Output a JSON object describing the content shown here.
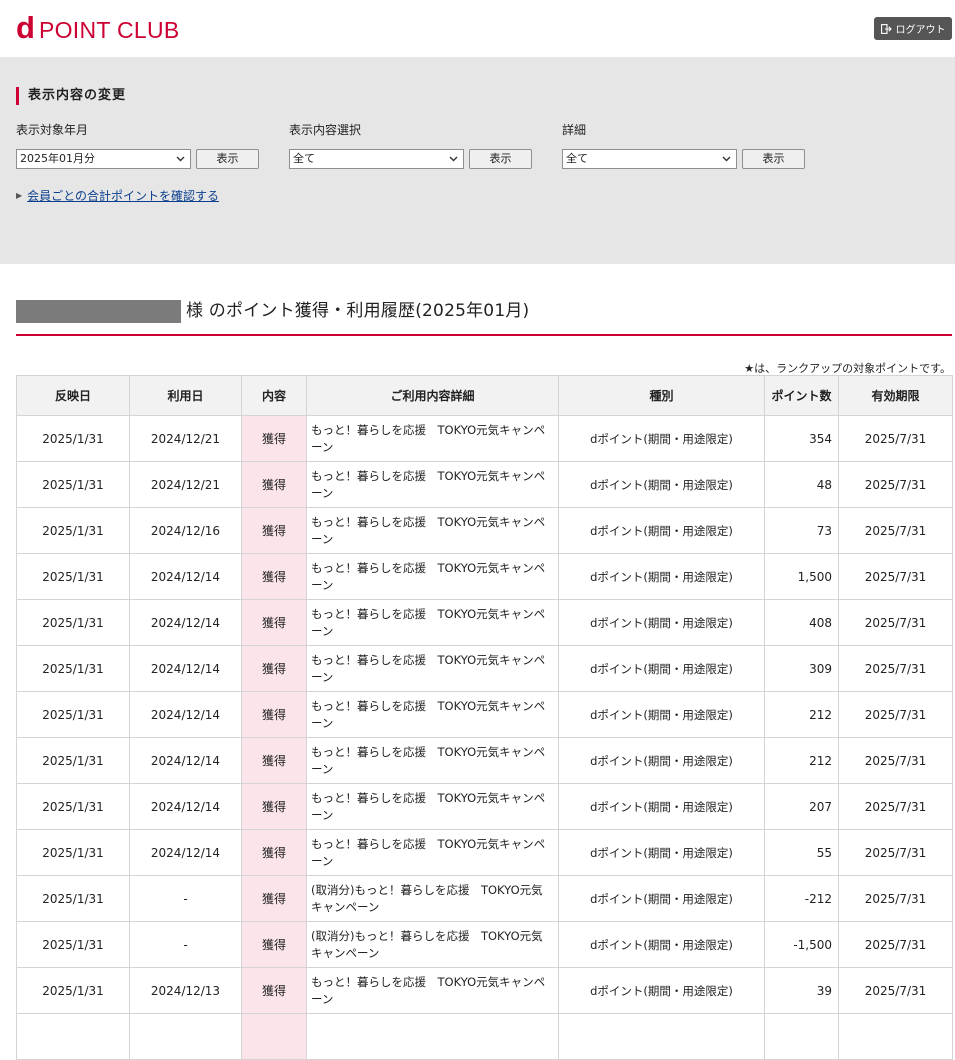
{
  "brand": {
    "logo_d": "d",
    "logo_text": "POINT CLUB"
  },
  "header": {
    "logout_label": "ログアウト"
  },
  "display_change": {
    "title": "表示内容の変更",
    "fields": [
      {
        "label": "表示対象年月",
        "selected": "2025年01月分",
        "button": "表示"
      },
      {
        "label": "表示内容選択",
        "selected": "全て",
        "button": "表示"
      },
      {
        "label": "詳細",
        "selected": "全て",
        "button": "表示"
      }
    ],
    "total_link": "会員ごとの合計ポイントを確認する"
  },
  "history": {
    "title": "様 のポイント獲得・利用履歴(2025年01月)",
    "note": "★は、ランクアップの対象ポイントです。",
    "columns": [
      "反映日",
      "利用日",
      "内容",
      "ご利用内容詳細",
      "種別",
      "ポイント数",
      "有効期限"
    ],
    "rows": [
      {
        "reflect": "2025/1/31",
        "use": "2024/12/21",
        "kind": "獲得",
        "detail": "もっと！暮らしを応援　TOKYO元気キャンペーン",
        "type": "dポイント(期間・用途限定)",
        "points": "354",
        "expiry": "2025/7/31"
      },
      {
        "reflect": "2025/1/31",
        "use": "2024/12/21",
        "kind": "獲得",
        "detail": "もっと！暮らしを応援　TOKYO元気キャンペーン",
        "type": "dポイント(期間・用途限定)",
        "points": "48",
        "expiry": "2025/7/31"
      },
      {
        "reflect": "2025/1/31",
        "use": "2024/12/16",
        "kind": "獲得",
        "detail": "もっと！暮らしを応援　TOKYO元気キャンペーン",
        "type": "dポイント(期間・用途限定)",
        "points": "73",
        "expiry": "2025/7/31"
      },
      {
        "reflect": "2025/1/31",
        "use": "2024/12/14",
        "kind": "獲得",
        "detail": "もっと！暮らしを応援　TOKYO元気キャンペーン",
        "type": "dポイント(期間・用途限定)",
        "points": "1,500",
        "expiry": "2025/7/31"
      },
      {
        "reflect": "2025/1/31",
        "use": "2024/12/14",
        "kind": "獲得",
        "detail": "もっと！暮らしを応援　TOKYO元気キャンペーン",
        "type": "dポイント(期間・用途限定)",
        "points": "408",
        "expiry": "2025/7/31"
      },
      {
        "reflect": "2025/1/31",
        "use": "2024/12/14",
        "kind": "獲得",
        "detail": "もっと！暮らしを応援　TOKYO元気キャンペーン",
        "type": "dポイント(期間・用途限定)",
        "points": "309",
        "expiry": "2025/7/31"
      },
      {
        "reflect": "2025/1/31",
        "use": "2024/12/14",
        "kind": "獲得",
        "detail": "もっと！暮らしを応援　TOKYO元気キャンペーン",
        "type": "dポイント(期間・用途限定)",
        "points": "212",
        "expiry": "2025/7/31"
      },
      {
        "reflect": "2025/1/31",
        "use": "2024/12/14",
        "kind": "獲得",
        "detail": "もっと！暮らしを応援　TOKYO元気キャンペーン",
        "type": "dポイント(期間・用途限定)",
        "points": "212",
        "expiry": "2025/7/31"
      },
      {
        "reflect": "2025/1/31",
        "use": "2024/12/14",
        "kind": "獲得",
        "detail": "もっと！暮らしを応援　TOKYO元気キャンペーン",
        "type": "dポイント(期間・用途限定)",
        "points": "207",
        "expiry": "2025/7/31"
      },
      {
        "reflect": "2025/1/31",
        "use": "2024/12/14",
        "kind": "獲得",
        "detail": "もっと！暮らしを応援　TOKYO元気キャンペーン",
        "type": "dポイント(期間・用途限定)",
        "points": "55",
        "expiry": "2025/7/31"
      },
      {
        "reflect": "2025/1/31",
        "use": "-",
        "kind": "獲得",
        "detail": "(取消分)もっと！暮らしを応援　TOKYO元気キャンペーン",
        "type": "dポイント(期間・用途限定)",
        "points": "-212",
        "expiry": "2025/7/31"
      },
      {
        "reflect": "2025/1/31",
        "use": "-",
        "kind": "獲得",
        "detail": "(取消分)もっと！暮らしを応援　TOKYO元気キャンペーン",
        "type": "dポイント(期間・用途限定)",
        "points": "-1,500",
        "expiry": "2025/7/31"
      },
      {
        "reflect": "2025/1/31",
        "use": "2024/12/13",
        "kind": "獲得",
        "detail": "もっと！暮らしを応援　TOKYO元気キャンペーン",
        "type": "dポイント(期間・用途限定)",
        "points": "39",
        "expiry": "2025/7/31"
      },
      {
        "reflect": "",
        "use": "",
        "kind": "",
        "detail": "",
        "type": "",
        "points": "",
        "expiry": ""
      }
    ]
  }
}
